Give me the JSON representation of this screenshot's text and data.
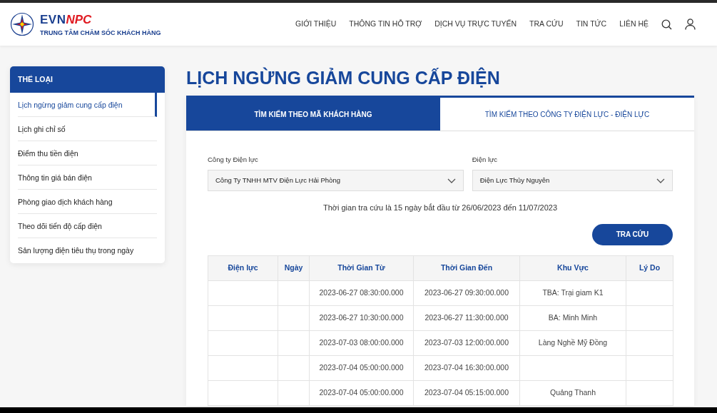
{
  "header": {
    "brand_evn": "EVN",
    "brand_npc": "NPC",
    "subtitle": "TRUNG TÂM CHĂM SÓC KHÁCH HÀNG",
    "nav": [
      "GIỚI THIỆU",
      "THÔNG TIN HỖ TRỢ",
      "DỊCH VỤ TRỰC TUYẾN",
      "TRA CỨU",
      "TIN TỨC",
      "LIÊN HỆ"
    ]
  },
  "sidebar": {
    "title": "THỂ LOẠI",
    "items": [
      {
        "label": "Lịch ngừng giảm cung cấp điện",
        "selected": true
      },
      {
        "label": "Lịch ghi chỉ số",
        "selected": false
      },
      {
        "label": "Điểm thu tiền điện",
        "selected": false
      },
      {
        "label": "Thông tin giá bán điện",
        "selected": false
      },
      {
        "label": "Phòng giao dịch khách hàng",
        "selected": false
      },
      {
        "label": "Theo dõi tiến độ cấp điện",
        "selected": false
      },
      {
        "label": "Sản lượng điện tiêu thụ trong ngày",
        "selected": false
      }
    ]
  },
  "page_title": "LỊCH NGỪNG GIẢM CUNG CẤP ĐIỆN",
  "tabs": [
    {
      "label": "TÌM KIẾM THEO MÃ KHÁCH HÀNG",
      "selected": true
    },
    {
      "label": "TÌM KIẾM THEO CÔNG TY ĐIỆN LỰC - ĐIỆN LỰC",
      "selected": false
    }
  ],
  "form": {
    "fields": [
      {
        "label": "Công ty Điện lực",
        "value": "Công Ty TNHH MTV Điện Lực Hải Phòng"
      },
      {
        "label": "Điện lực",
        "value": "Điện Lực Thủy Nguyên"
      }
    ],
    "note": "Thời gian tra cứu là 15 ngày bắt đầu từ 26/06/2023 đến 11/07/2023",
    "button": "TRA CỨU"
  },
  "table": {
    "columns": [
      "Điện lực",
      "Ngày",
      "Thời Gian Từ",
      "Thời Gian Đến",
      "Khu Vực",
      "Lý Do"
    ],
    "rows": [
      [
        "",
        "",
        "2023-06-27 08:30:00.000",
        "2023-06-27 09:30:00.000",
        "TBA: Trại giam K1",
        ""
      ],
      [
        "",
        "",
        "2023-06-27 10:30:00.000",
        "2023-06-27 11:30:00.000",
        "BA: Minh Minh",
        ""
      ],
      [
        "",
        "",
        "2023-07-03 08:00:00.000",
        "2023-07-03 12:00:00.000",
        "Làng Nghề Mỹ Đồng",
        ""
      ],
      [
        "",
        "",
        "2023-07-04 05:00:00.000",
        "2023-07-04 16:30:00.000",
        "",
        ""
      ],
      [
        "",
        "",
        "2023-07-04 05:00:00.000",
        "2023-07-04 05:15:00.000",
        "Quảng Thanh",
        ""
      ]
    ]
  }
}
